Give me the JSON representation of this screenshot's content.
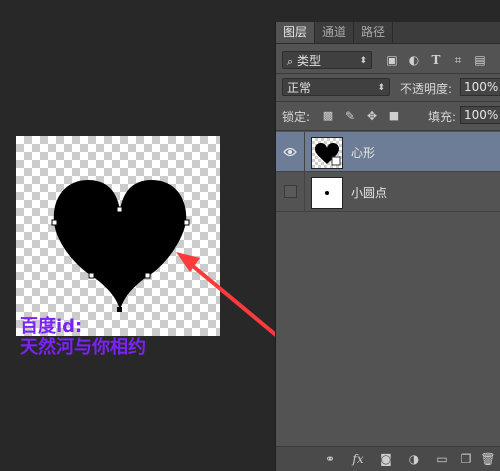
{
  "tabs": [
    {
      "label": "图层"
    },
    {
      "label": "通道"
    },
    {
      "label": "路径"
    }
  ],
  "filter": {
    "kind_label": "类型",
    "icons": [
      "image-filter-icon",
      "adjustment-filter-icon",
      "type-filter-icon",
      "shape-filter-icon",
      "smart-object-filter-icon"
    ]
  },
  "blend": {
    "mode": "正常",
    "opacity_label": "不透明度:",
    "opacity_value": "100%"
  },
  "lock": {
    "label": "锁定:",
    "fill_label": "填充:",
    "fill_value": "100%"
  },
  "layers": [
    {
      "name": "心形",
      "selected": true,
      "visible": true
    },
    {
      "name": "小圆点",
      "selected": false,
      "visible": false
    }
  ],
  "watermark": {
    "line1": "百度id:",
    "line2": "天然河与你相约",
    "color": "#7b22f5"
  },
  "bottom_icons": [
    "link-icon",
    "fx-icon",
    "mask-icon",
    "adjustment-icon",
    "folder-icon",
    "new-layer-icon",
    "trash-icon"
  ],
  "colors": {
    "arrow": "#ff3a3a",
    "selected_layer": "#6e7d97"
  }
}
